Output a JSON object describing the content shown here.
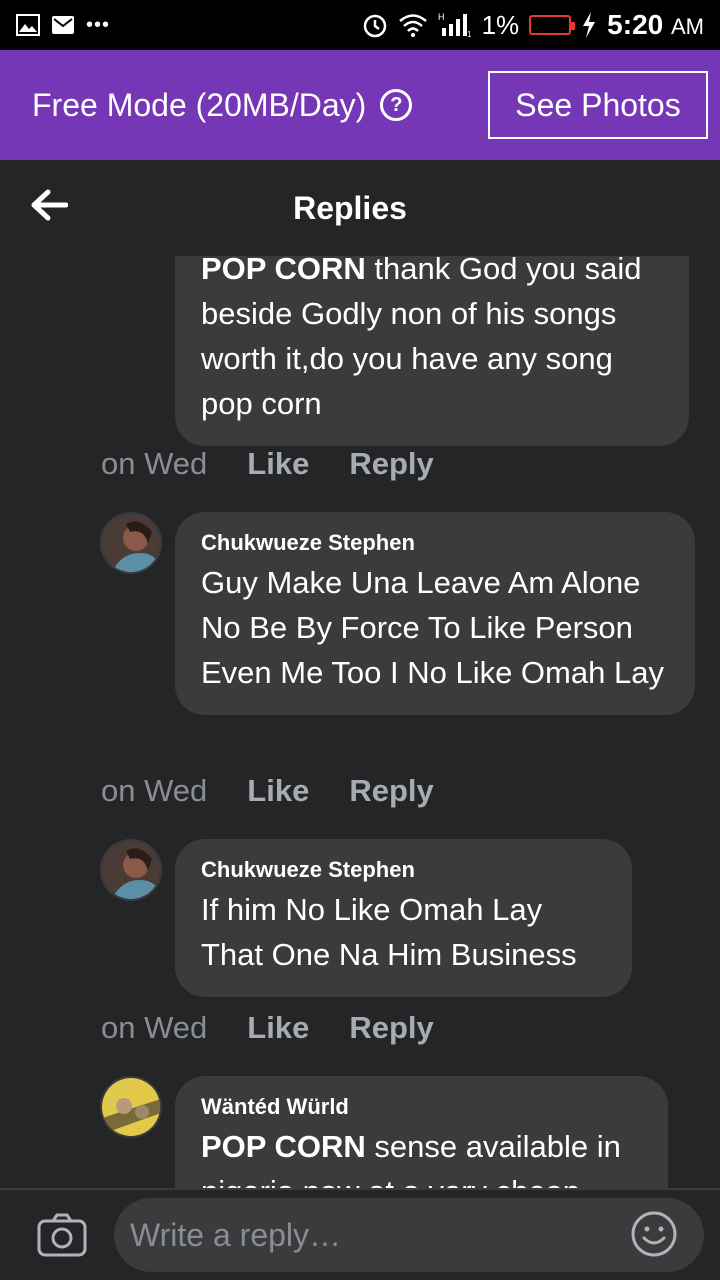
{
  "status_bar": {
    "battery_pct": "1%",
    "time": "5:20",
    "ampm": "AM"
  },
  "banner": {
    "free_mode_text": "Free Mode (20MB/Day)",
    "help_symbol": "?",
    "see_photos_label": "See Photos"
  },
  "header": {
    "title": "Replies"
  },
  "comments": [
    {
      "author": "",
      "mention": "POP CORN",
      "text_top": " thank God you said",
      "text_rest": "beside Godly non of his songs worth it,do you have any song pop corn",
      "time": "on Wed",
      "like": "Like",
      "reply": "Reply"
    },
    {
      "author": "Chukwueze Stephen",
      "text": "Guy Make Una Leave Am Alone No Be By Force To Like Person Even Me Too I No Like Omah Lay",
      "time": "on Wed",
      "like": "Like",
      "reply": "Reply"
    },
    {
      "author": "Chukwueze Stephen",
      "text": "If him No Like Omah Lay That One Na Him Business",
      "time": "on Wed",
      "like": "Like",
      "reply": "Reply"
    },
    {
      "author": "Wäntéd Würld",
      "mention": "POP CORN",
      "text": " sense available in nigeria now at a very cheap"
    }
  ],
  "footer": {
    "placeholder": "Write a reply…"
  },
  "colors": {
    "banner": "#7637b6",
    "bubble": "#3a3b3c",
    "background": "#242526"
  },
  "icons": [
    "image-icon",
    "mail-icon",
    "more-icon",
    "alarm-icon",
    "wifi-icon",
    "signal-icon",
    "battery-icon",
    "charging-icon",
    "help-icon",
    "back-arrow-icon",
    "camera-icon",
    "emoji-icon"
  ]
}
